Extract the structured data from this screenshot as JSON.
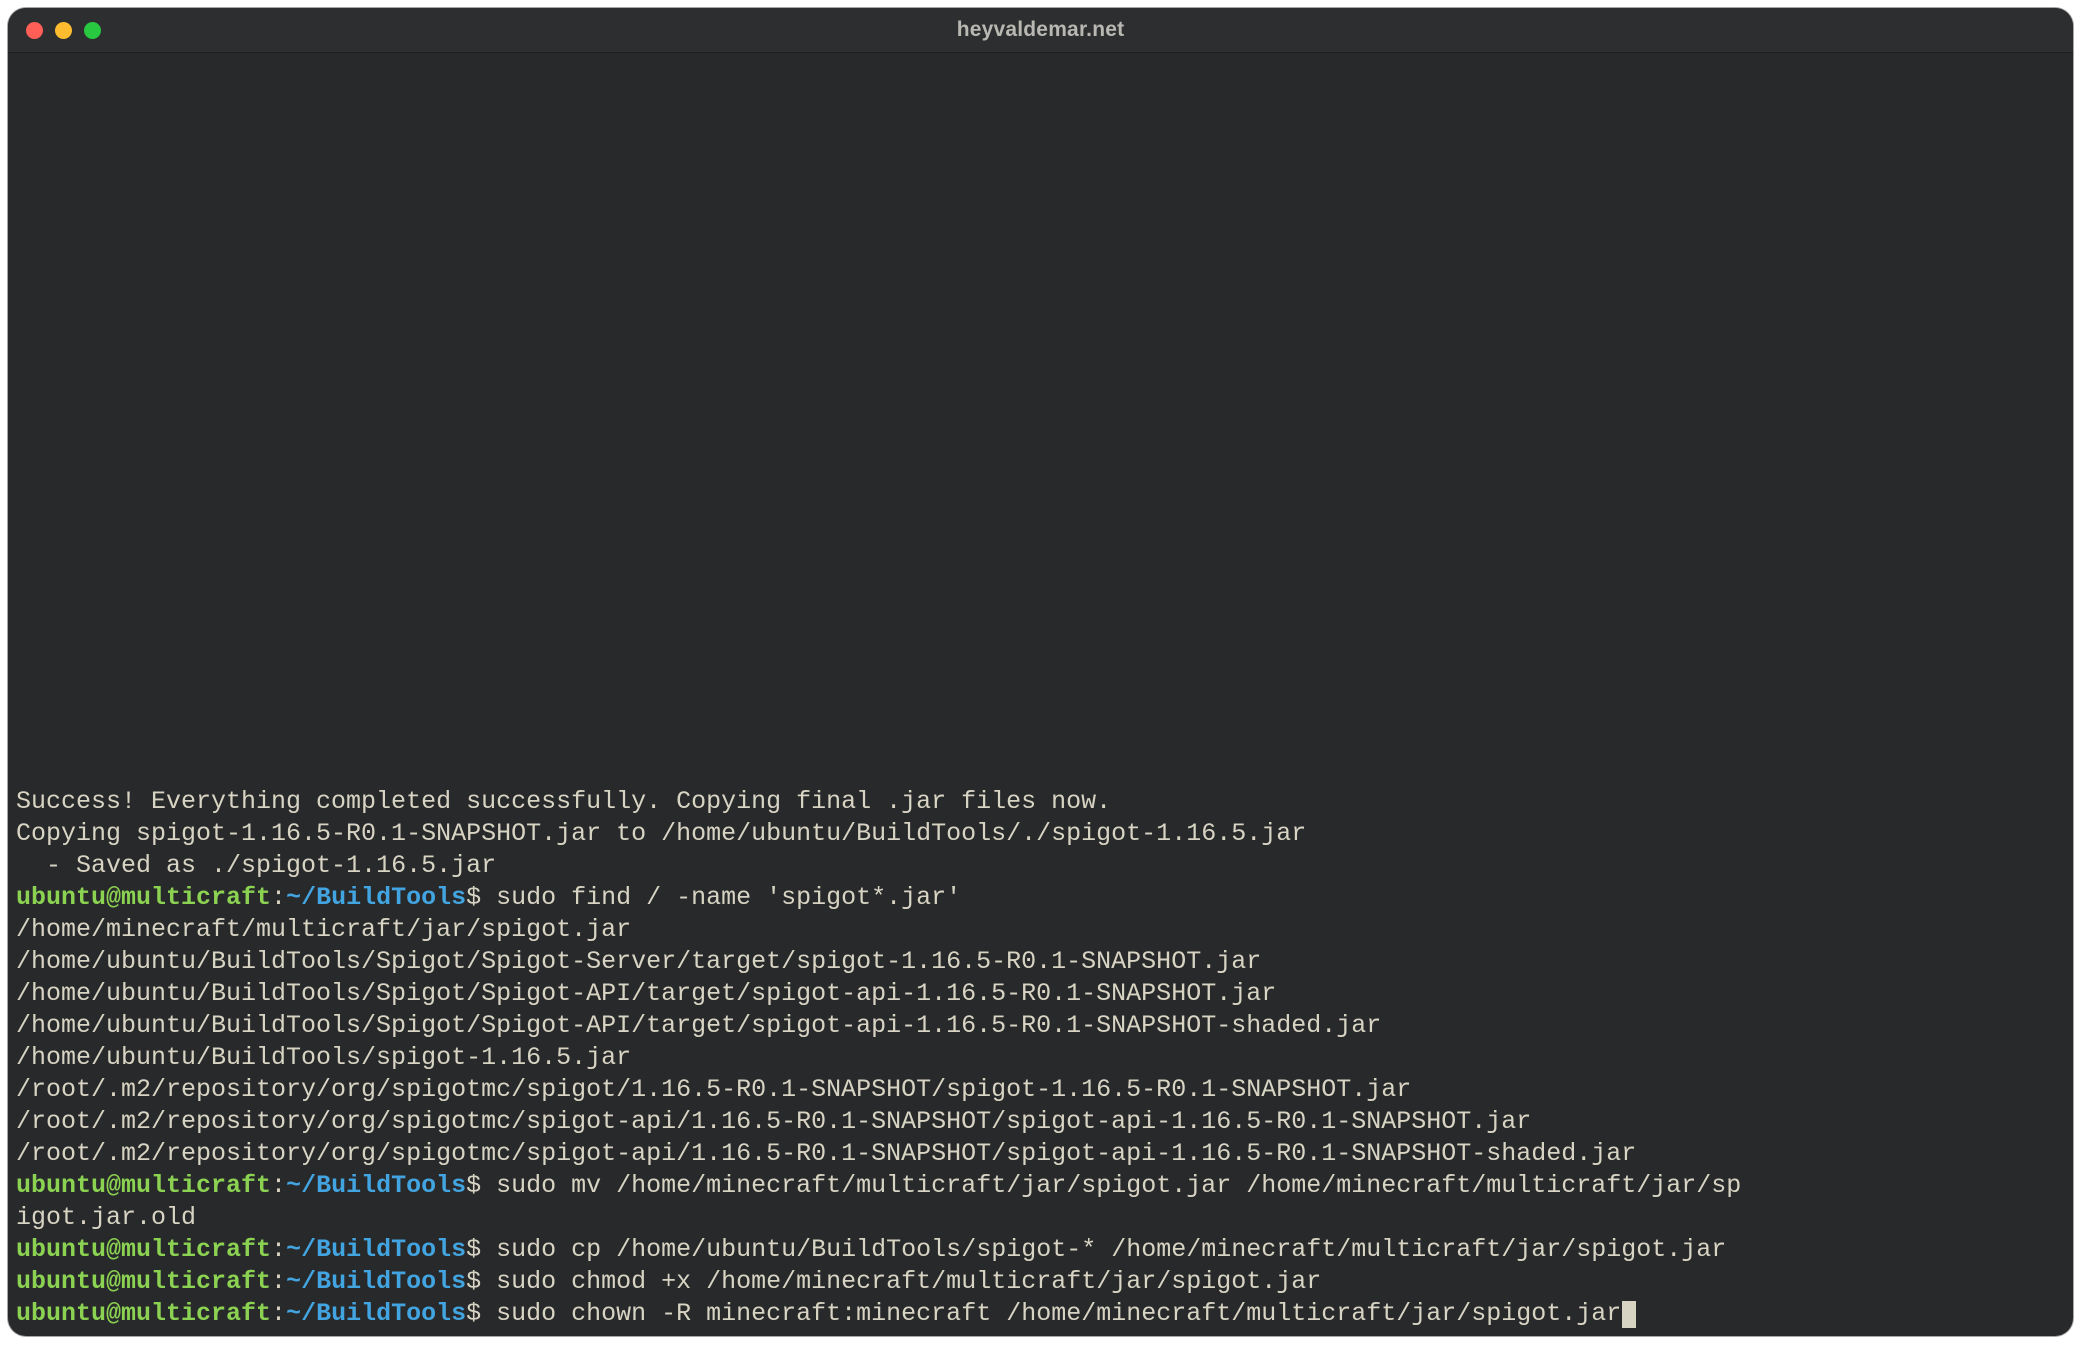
{
  "window": {
    "title": "heyvaldemar.net"
  },
  "prompt": {
    "userhost": "ubuntu@multicraft",
    "colon": ":",
    "path": "~/BuildTools",
    "dollar": "$"
  },
  "lines": {
    "o0": "Success! Everything completed successfully. Copying final .jar files now.",
    "o1": "Copying spigot-1.16.5-R0.1-SNAPSHOT.jar to /home/ubuntu/BuildTools/./spigot-1.16.5.jar",
    "o2": "  - Saved as ./spigot-1.16.5.jar",
    "c0": " sudo find / -name 'spigot*.jar'",
    "f0": "/home/minecraft/multicraft/jar/spigot.jar",
    "f1": "/home/ubuntu/BuildTools/Spigot/Spigot-Server/target/spigot-1.16.5-R0.1-SNAPSHOT.jar",
    "f2": "/home/ubuntu/BuildTools/Spigot/Spigot-API/target/spigot-api-1.16.5-R0.1-SNAPSHOT.jar",
    "f3": "/home/ubuntu/BuildTools/Spigot/Spigot-API/target/spigot-api-1.16.5-R0.1-SNAPSHOT-shaded.jar",
    "f4": "/home/ubuntu/BuildTools/spigot-1.16.5.jar",
    "f5": "/root/.m2/repository/org/spigotmc/spigot/1.16.5-R0.1-SNAPSHOT/spigot-1.16.5-R0.1-SNAPSHOT.jar",
    "f6": "/root/.m2/repository/org/spigotmc/spigot-api/1.16.5-R0.1-SNAPSHOT/spigot-api-1.16.5-R0.1-SNAPSHOT.jar",
    "f7": "/root/.m2/repository/org/spigotmc/spigot-api/1.16.5-R0.1-SNAPSHOT/spigot-api-1.16.5-R0.1-SNAPSHOT-shaded.jar",
    "c1a": " sudo mv /home/minecraft/multicraft/jar/spigot.jar /home/minecraft/multicraft/jar/sp",
    "c1b": "igot.jar.old",
    "c2": " sudo cp /home/ubuntu/BuildTools/spigot-* /home/minecraft/multicraft/jar/spigot.jar",
    "c3": " sudo chmod +x /home/minecraft/multicraft/jar/spigot.jar",
    "c4": " sudo chown -R minecraft:minecraft /home/minecraft/multicraft/jar/spigot.jar"
  }
}
